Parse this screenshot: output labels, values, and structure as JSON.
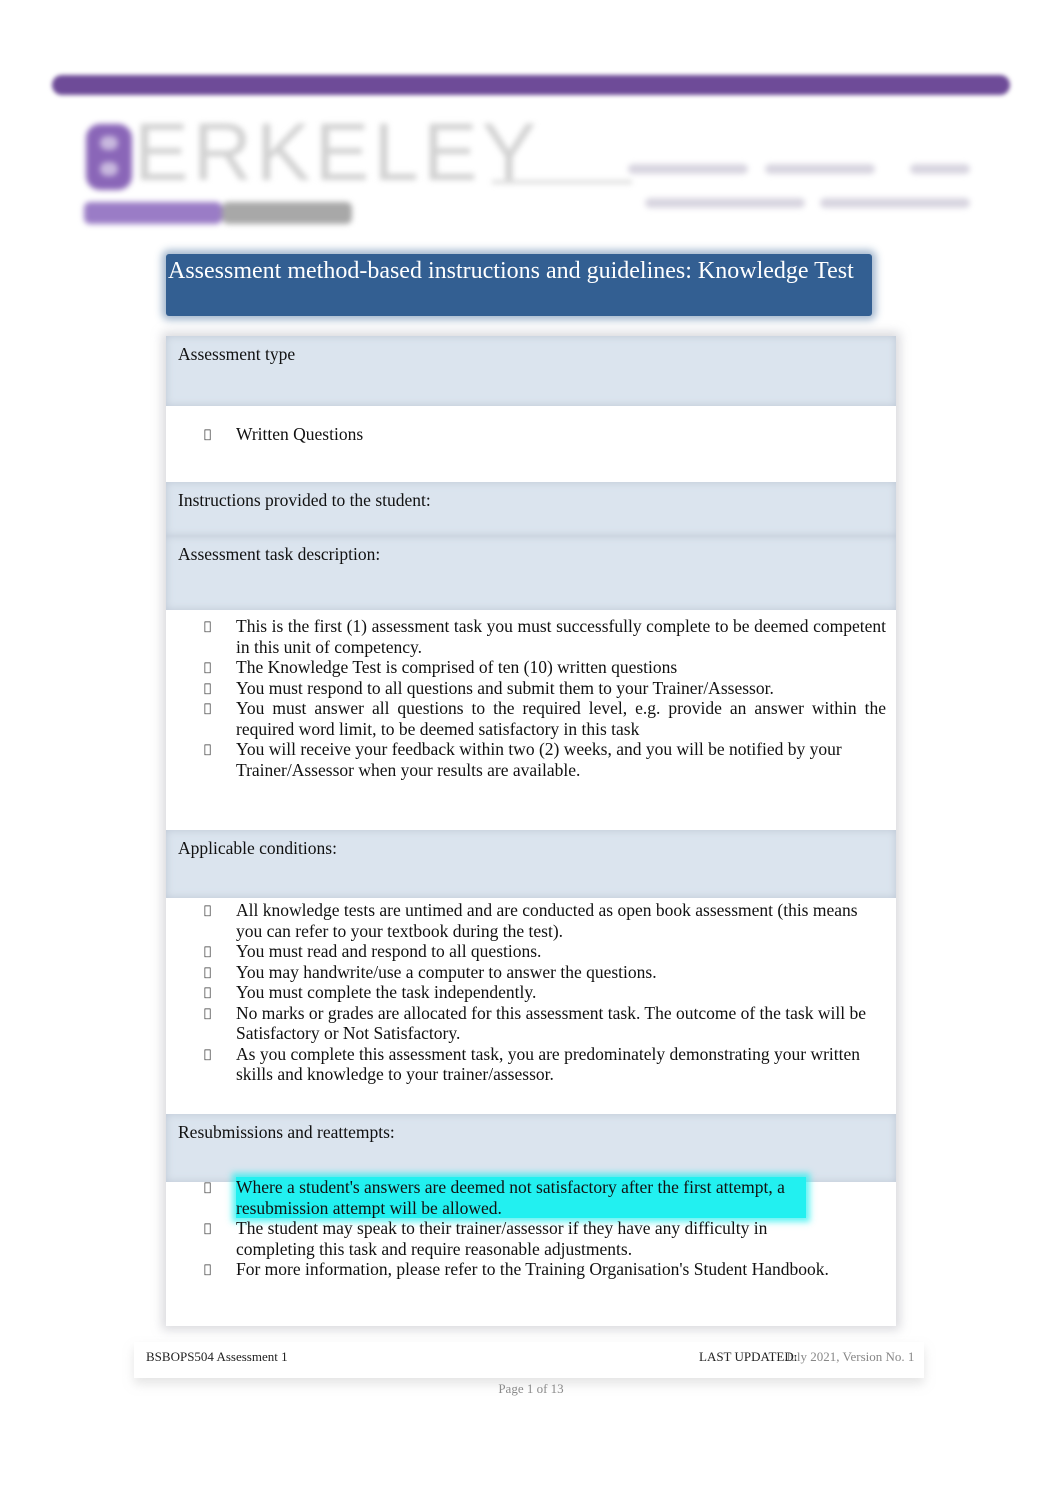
{
  "header": {
    "logo_text": "ERKELEY",
    "logo_initial": "B"
  },
  "title": "Assessment method-based instructions and guidelines: Knowledge Test",
  "sections": [
    {
      "label": "Assessment type",
      "items": [
        "Written Questions"
      ]
    },
    {
      "label": "Instructions provided to the student:",
      "items": []
    },
    {
      "label": "Assessment task description:",
      "items": [
        "This is the first (1) assessment task you must successfully complete to be deemed competent in this unit of competency.",
        "The Knowledge Test is comprised of ten (10) written questions",
        "You must respond to all questions and submit them to your Trainer/Assessor.",
        "You must answer all questions to the required level, e.g. provide an answer within the required word limit, to be deemed satisfactory in this task",
        "You will receive your feedback within two (2) weeks, and you will be notified by your Trainer/Assessor when your results are available."
      ]
    },
    {
      "label": "Applicable conditions:",
      "items": [
        "All knowledge tests are untimed and are conducted as open book assessment (this means you can refer to your textbook during the test).",
        "You must read and respond to all questions.",
        "You may handwrite/use a computer to answer the questions.",
        "You must complete the task independently.",
        "No marks or grades are allocated for this assessment task. The outcome of the task will be Satisfactory or Not Satisfactory.",
        "As you complete this assessment task, you are predominately demonstrating your written skills and knowledge to your trainer/assessor."
      ]
    },
    {
      "label": "Resubmissions and reattempts:",
      "items": [
        "Where a student's answers are deemed not satisfactory after the first attempt, a resubmission attempt will be allowed.",
        "The student may speak to their trainer/assessor if they have any difficulty in completing this task and require reasonable adjustments.",
        "For more information, please refer to the Training Organisation's Student Handbook."
      ],
      "highlighted_item_index": 0
    }
  ],
  "bullet_glyph": "",
  "footer": {
    "left": "BSBOPS504 Assessment 1",
    "last_updated_label": "LAST UPDATED:",
    "last_updated_value": "July 2021, Version No. 1",
    "page": "Page 1 of 13"
  },
  "colors": {
    "brand_purple": "#6e4b98",
    "title_blue": "#335f92",
    "section_head_bg": "#dbe4ee",
    "highlight": "#22f0f0"
  }
}
